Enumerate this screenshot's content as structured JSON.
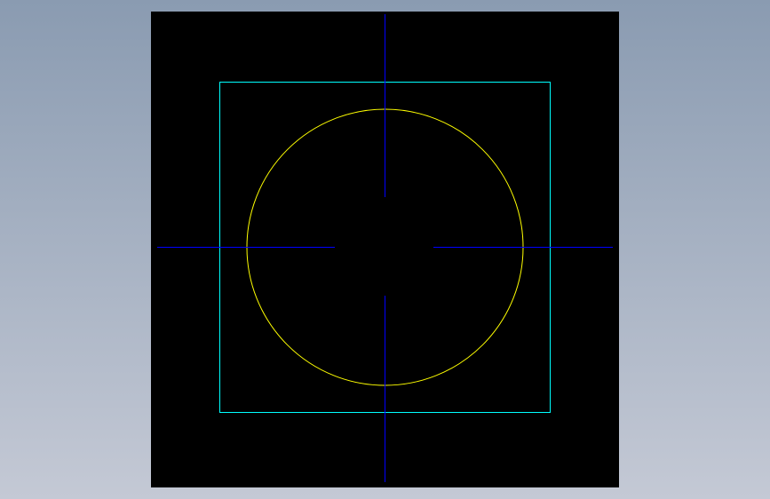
{
  "background": {
    "gradient_top": "#8a9bb1",
    "gradient_bottom": "#c4c9d5"
  },
  "viewport": {
    "background_color": "#000000"
  },
  "drawing": {
    "frame_color": "#00ffff",
    "circle_color": "#ffff00",
    "centerline_color": "#0000ff"
  }
}
